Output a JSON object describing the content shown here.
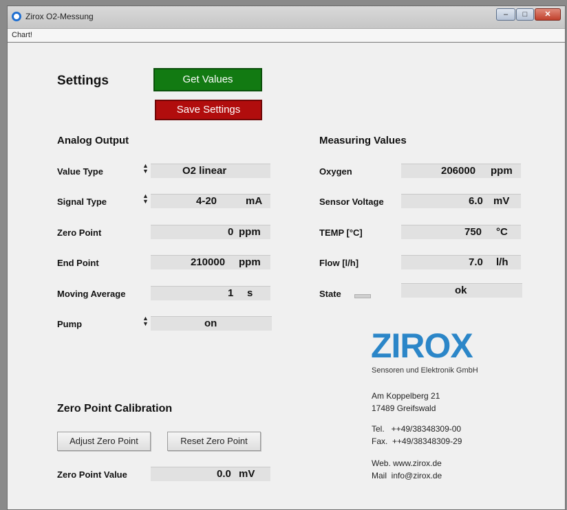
{
  "window": {
    "title": "Zirox O2-Messung",
    "min_label": "–",
    "max_label": "□",
    "close_label": "✕"
  },
  "menu": {
    "chart_label": "Chart!"
  },
  "settings": {
    "title": "Settings",
    "get_values_label": "Get Values",
    "save_settings_label": "Save Settings"
  },
  "analog_output": {
    "title": "Analog Output",
    "value_type_label": "Value Type",
    "value_type_value": "O2 linear",
    "signal_type_label": "Signal Type",
    "signal_type_value": "4-20",
    "signal_type_unit": "mA",
    "zero_point_label": "Zero Point",
    "zero_point_value": "0",
    "zero_point_unit": "ppm",
    "end_point_label": "End Point",
    "end_point_value": "210000",
    "end_point_unit": "ppm",
    "moving_average_label": "Moving Average",
    "moving_average_value": "1",
    "moving_average_unit": "s",
    "pump_label": "Pump",
    "pump_value": "on"
  },
  "measuring": {
    "title": "Measuring Values",
    "oxygen_label": "Oxygen",
    "oxygen_value": "206000",
    "oxygen_unit": "ppm",
    "sensor_voltage_label": "Sensor Voltage",
    "sensor_voltage_value": "6.0",
    "sensor_voltage_unit": "mV",
    "temp_label": "TEMP [°C]",
    "temp_value": "750",
    "temp_unit": "°C",
    "flow_label": "Flow [l/h]",
    "flow_value": "7.0",
    "flow_unit": "l/h",
    "state_label": "State",
    "state_value": "ok"
  },
  "calibration": {
    "title": "Zero Point Calibration",
    "adjust_label": "Adjust Zero Point",
    "reset_label": "Reset Zero Point",
    "zero_value_label": "Zero Point Value",
    "zero_value_value": "0.0",
    "zero_value_unit": "mV"
  },
  "company": {
    "logo_text": "ZIROX",
    "tagline": "Sensoren und Elektronik GmbH",
    "street": "Am Koppelberg 21",
    "city": "17489 Greifswald",
    "tel": "Tel.   ++49/38348309-00",
    "fax": "Fax.  ++49/38348309-29",
    "web": "Web. www.zirox.de",
    "mail": "Mail  info@zirox.de"
  },
  "colors": {
    "accent_green": "#127a12",
    "accent_red": "#b10d0d",
    "logo_blue": "#2b86c8"
  }
}
